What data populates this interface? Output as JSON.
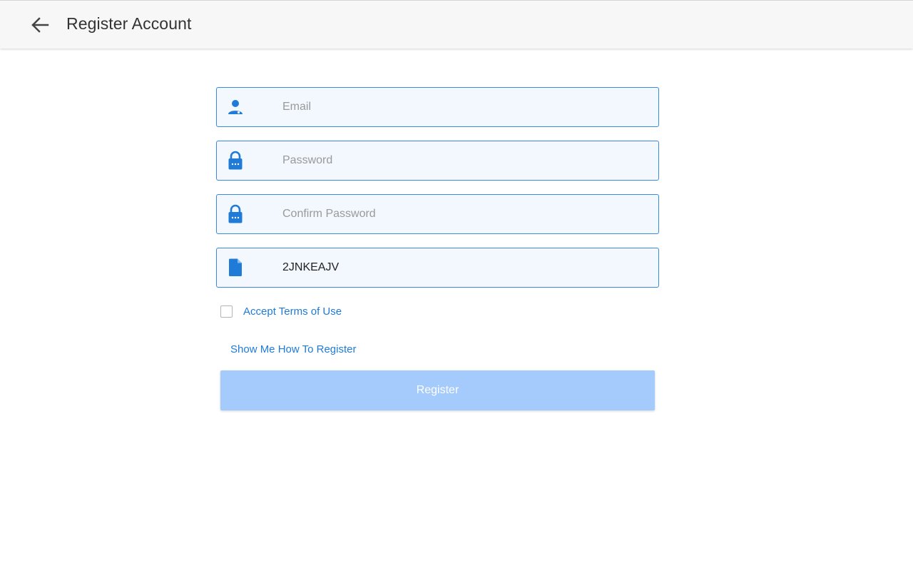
{
  "appbar": {
    "title": "Register Account",
    "back_icon": "arrow-left-icon"
  },
  "form": {
    "email": {
      "placeholder": "Email",
      "value": "",
      "icon": "person-icon"
    },
    "password": {
      "placeholder": "Password",
      "value": "",
      "icon": "lock-icon"
    },
    "confirm_password": {
      "placeholder": "Confirm Password",
      "value": "",
      "icon": "lock-icon"
    },
    "code": {
      "placeholder": "",
      "value": "2JNKEAJV",
      "icon": "document-icon"
    },
    "terms": {
      "label": "Accept Terms of Use",
      "checked": false
    },
    "howto_link": "Show Me How To Register",
    "register_label": "Register"
  },
  "colors": {
    "accent": "#1f7ad8",
    "field_border": "#3a8ae0",
    "field_bg": "#f3f8fe",
    "button_disabled": "#a4cbfb",
    "appbar_bg": "#f7f7f7"
  }
}
